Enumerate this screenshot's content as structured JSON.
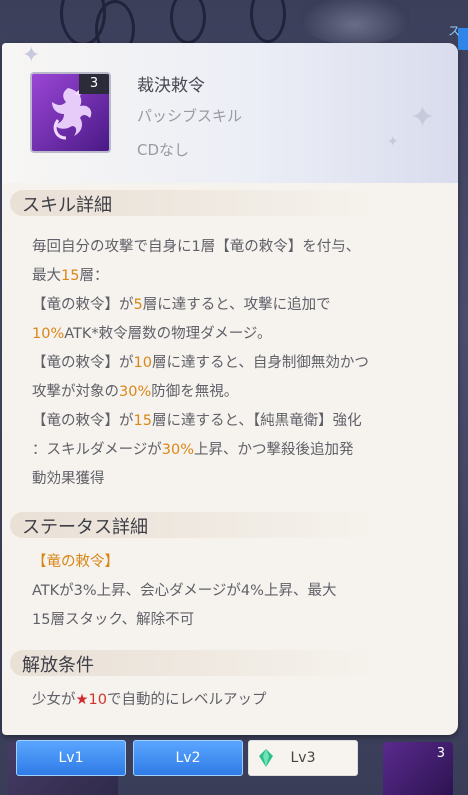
{
  "background": {
    "edge_label": "ス"
  },
  "skill": {
    "icon": "dragon-icon",
    "level_badge": "3",
    "name": "裁決敕令",
    "type": "パッシブスキル",
    "cooldown": "CDなし"
  },
  "sections": {
    "detail_title": "スキル詳細",
    "status_title": "ステータス詳細",
    "unlock_title": "解放条件"
  },
  "detail_lines": [
    [
      {
        "t": "毎回自分の攻撃で自身に1層【竜の敕令】を付与、"
      }
    ],
    [
      {
        "t": "最大"
      },
      {
        "t": "15",
        "c": "hl"
      },
      {
        "t": "層："
      }
    ],
    [
      {
        "t": "【竜の敕令】が"
      },
      {
        "t": "5",
        "c": "hl"
      },
      {
        "t": "層に達すると、攻撃に追加で"
      }
    ],
    [
      {
        "t": "10%",
        "c": "hl"
      },
      {
        "t": "ATK*敕令層数の物理ダメージ。"
      }
    ],
    [
      {
        "t": "【竜の敕令】が"
      },
      {
        "t": "10",
        "c": "hl"
      },
      {
        "t": "層に達すると、自身制御無効かつ"
      }
    ],
    [
      {
        "t": "攻撃が対象の"
      },
      {
        "t": "30%",
        "c": "hl"
      },
      {
        "t": "防御を無視。"
      }
    ],
    [
      {
        "t": "【竜の敕令】が"
      },
      {
        "t": "15",
        "c": "hl"
      },
      {
        "t": "層に達すると、【純黒竜衛】強化"
      }
    ],
    [
      {
        "t": "：スキルダメージが"
      },
      {
        "t": "30%",
        "c": "hl"
      },
      {
        "t": "上昇、かつ撃殺後追加発"
      }
    ],
    [
      {
        "t": "動効果獲得"
      }
    ]
  ],
  "status": {
    "buff_name": "【竜の敕令】",
    "lines": [
      "ATKが3%上昇、会心ダメージが4%上昇、最大",
      "15層スタック、解除不可"
    ]
  },
  "unlock": {
    "prefix": "少女が",
    "star": "★",
    "value": "10",
    "suffix": "で自動的にレベルアップ"
  },
  "level_tabs": [
    {
      "label": "Lv1",
      "active": false
    },
    {
      "label": "Lv2",
      "active": false
    },
    {
      "label": "Lv3",
      "active": true
    }
  ],
  "bottom_icon": {
    "icon": "dragon-icon",
    "level_badge": "3"
  },
  "colors": {
    "highlight": "#d98718",
    "star": "#d22a2a",
    "tab_blue": "#2f7be6",
    "icon_purple": "#7a2fc0"
  }
}
